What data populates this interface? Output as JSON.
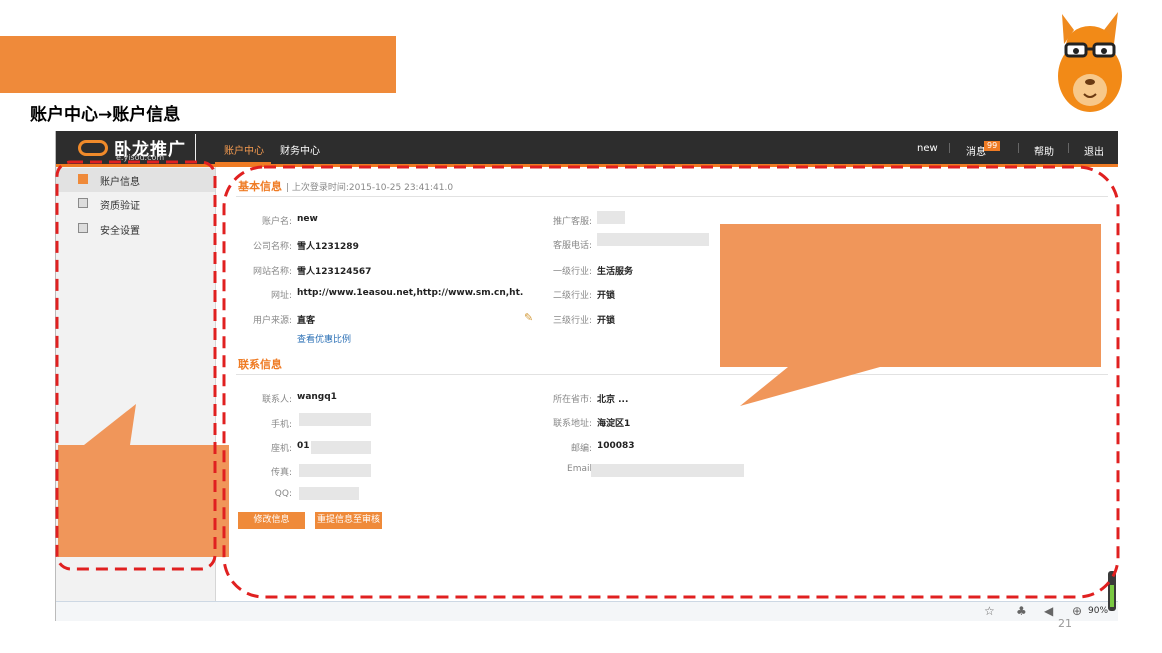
{
  "slide": {
    "title": "账户中心→账户信息",
    "page_number": "21"
  },
  "app": {
    "logo_text": "卧龙推广",
    "logo_sub": "e.yisou.com",
    "nav_tabs": [
      {
        "label": "账户中心",
        "active": true
      },
      {
        "label": "财务中心",
        "active": false
      }
    ],
    "top_right": {
      "username": "new",
      "messages_label": "消息",
      "messages_count": "99",
      "help": "帮助",
      "logout": "退出"
    },
    "sidebar": [
      {
        "label": "账户信息",
        "active": true,
        "icon": "account-icon"
      },
      {
        "label": "资质验证",
        "active": false,
        "icon": "verify-icon"
      },
      {
        "label": "安全设置",
        "active": false,
        "icon": "lock-icon"
      }
    ],
    "basic_info": {
      "title": "基本信息",
      "last_login": "| 上次登录时间:2015-10-25 23:41:41.0",
      "left": [
        {
          "label": "账户名:",
          "value": "new"
        },
        {
          "label": "公司名称:",
          "value": "雪人1231289"
        },
        {
          "label": "网站名称:",
          "value": "雪人123124567"
        },
        {
          "label": "网址:",
          "value": "http://www.1easou.net,http://www.sm.cn,ht."
        },
        {
          "label": "用户来源:",
          "value": "直客"
        }
      ],
      "discount_link": "查看优惠比例",
      "right": [
        {
          "label": "推广客服:",
          "value": ""
        },
        {
          "label": "客服电话:",
          "value": ""
        },
        {
          "label": "一级行业:",
          "value": "生活服务"
        },
        {
          "label": "二级行业:",
          "value": "开锁"
        },
        {
          "label": "三级行业:",
          "value": "开锁"
        }
      ]
    },
    "contact_info": {
      "title": "联系信息",
      "left": [
        {
          "label": "联系人:",
          "value": "wangq1"
        },
        {
          "label": "手机:",
          "value": ""
        },
        {
          "label": "座机:",
          "value": "01"
        },
        {
          "label": "传真:",
          "value": ""
        },
        {
          "label": "QQ:",
          "value": ""
        }
      ],
      "right": [
        {
          "label": "所在省市:",
          "value": "北京 ..."
        },
        {
          "label": "联系地址:",
          "value": "海淀区1"
        },
        {
          "label": "邮编:",
          "value": "100083"
        },
        {
          "label": "Email",
          "value": ""
        }
      ]
    },
    "buttons": {
      "edit": "修改信息",
      "resubmit": "重提信息至审核"
    },
    "statusbar": {
      "zoom": "90%"
    }
  },
  "colors": {
    "accent": "#ef8a3a",
    "topbar": "#2d2d2d",
    "annotation_red": "#e02020",
    "callout": "#f0965a"
  }
}
